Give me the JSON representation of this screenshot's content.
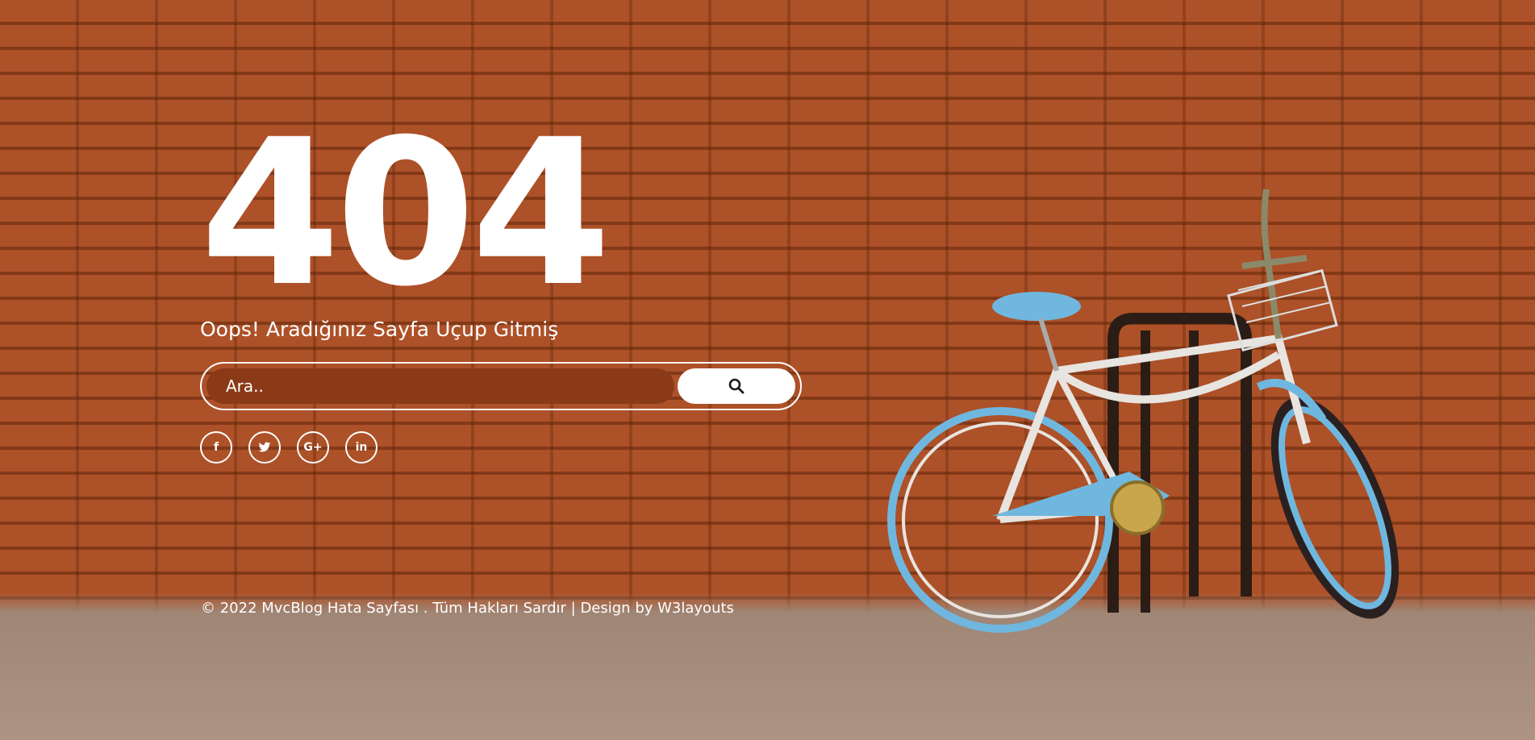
{
  "hero": {
    "error_code": "404",
    "subtitle": "Oops! Aradığınız Sayfa Uçup Gitmiş"
  },
  "search": {
    "placeholder": "Ara..",
    "button_icon": "search-icon"
  },
  "social": [
    {
      "icon": "facebook-icon",
      "glyph": "f"
    },
    {
      "icon": "twitter-icon",
      "glyph": "t"
    },
    {
      "icon": "google-plus-icon",
      "glyph": "G+"
    },
    {
      "icon": "linkedin-icon",
      "glyph": "in"
    }
  ],
  "footer": {
    "copyright": "© 2022 MvcBlog Hata Sayfası . Tüm Hakları Sardır | Design by ",
    "link": "W3layouts"
  },
  "colors": {
    "wall": "#b95a2e",
    "input_bg": "#8a3a17",
    "text": "#ffffff"
  }
}
